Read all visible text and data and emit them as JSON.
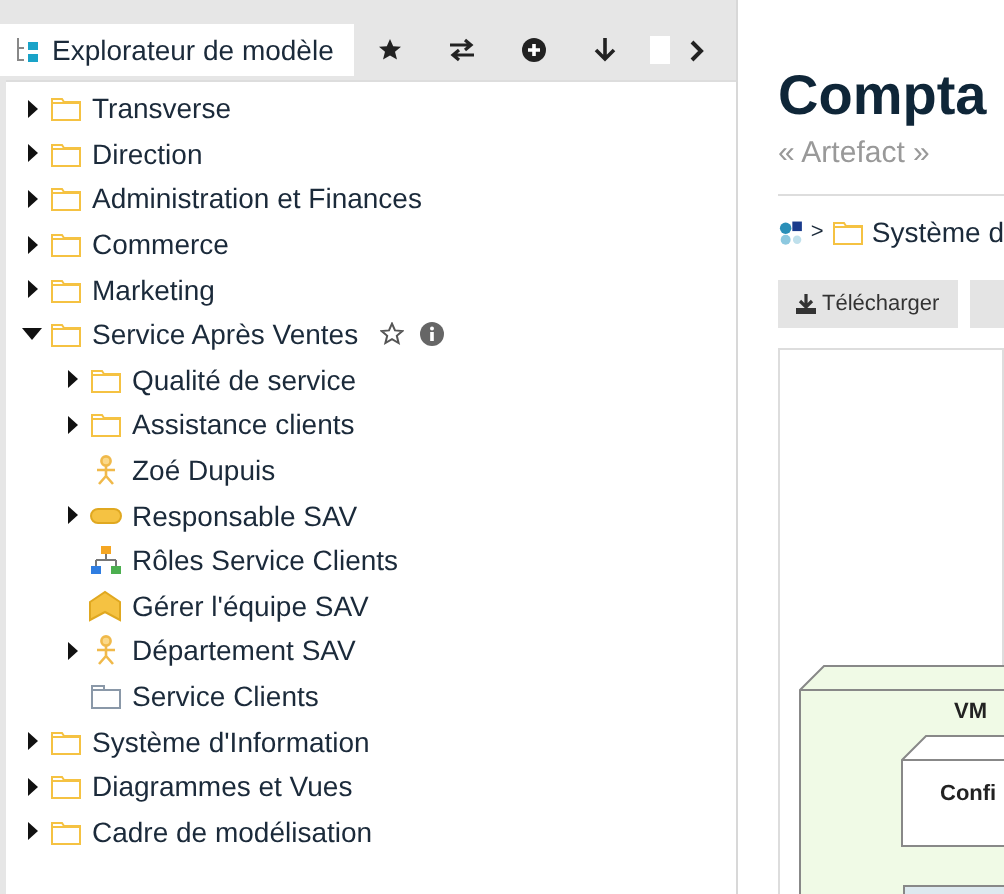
{
  "explorer": {
    "tab": {
      "label": "Explorateur de modèle",
      "selected": true
    },
    "tree": [
      {
        "label": "Transverse",
        "kind": "folder",
        "expanded": false,
        "hovered": false
      },
      {
        "label": "Direction",
        "kind": "folder",
        "expanded": false,
        "hovered": false
      },
      {
        "label": "Administration et Finances",
        "kind": "folder",
        "expanded": false,
        "hovered": false
      },
      {
        "label": "Commerce",
        "kind": "folder",
        "expanded": false,
        "hovered": false
      },
      {
        "label": "Marketing",
        "kind": "folder",
        "expanded": false,
        "hovered": false
      },
      {
        "label": "Service Après Ventes",
        "kind": "folder",
        "expanded": true,
        "hovered": true,
        "children": [
          {
            "label": "Qualité de service",
            "kind": "folder",
            "expanded": false,
            "hovered": false
          },
          {
            "label": "Assistance clients",
            "kind": "folder",
            "expanded": false,
            "hovered": false
          },
          {
            "label": "Zoé Dupuis",
            "kind": "actor",
            "hovered": false
          },
          {
            "label": "Responsable SAV",
            "kind": "role",
            "expanded": false,
            "hovered": false
          },
          {
            "label": "Rôles Service Clients",
            "kind": "hierarchy",
            "hovered": false
          },
          {
            "label": "Gérer l'équipe SAV",
            "kind": "process",
            "hovered": false
          },
          {
            "label": "Département SAV",
            "kind": "actor",
            "expanded": false,
            "hovered": false
          },
          {
            "label": "Service Clients",
            "kind": "package",
            "hovered": false
          }
        ]
      },
      {
        "label": "Système d'Information",
        "kind": "folder",
        "expanded": false,
        "hovered": false
      },
      {
        "label": "Diagrammes et Vues",
        "kind": "folder",
        "expanded": false,
        "hovered": false
      },
      {
        "label": "Cadre de modélisation",
        "kind": "folder",
        "expanded": false,
        "hovered": false
      }
    ]
  },
  "detail": {
    "title": "Compta",
    "stereotype": "« Artefact »",
    "breadcrumb_separator": ">",
    "breadcrumb": [
      "Système d"
    ],
    "buttons": [
      "Télécharger"
    ],
    "diagram": {
      "nodes": [
        "VM",
        "Confi"
      ]
    }
  }
}
